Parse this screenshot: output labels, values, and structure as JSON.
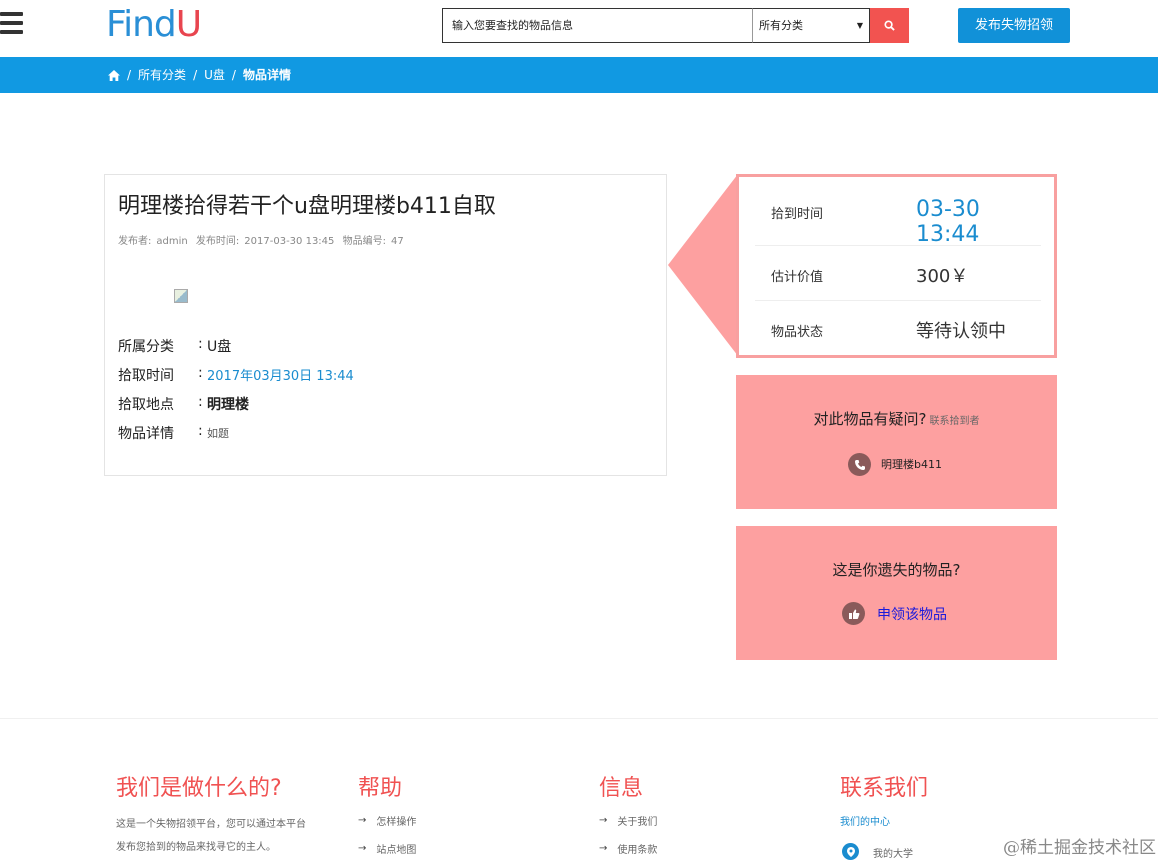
{
  "header": {
    "logo_part1": "Find",
    "logo_part2": "U",
    "search_placeholder": "输入您要查找的物品信息",
    "category_selected": "所有分类",
    "publish_label": "发布失物招领"
  },
  "breadcrumb": {
    "items": [
      "所有分类",
      "U盘",
      "物品详情"
    ]
  },
  "item": {
    "title": "明理楼拾得若干个u盘明理楼b411自取",
    "publisher_label": "发布者:",
    "publisher": "admin",
    "time_label": "发布时间:",
    "time": "2017-03-30 13:45",
    "id_label": "物品编号:",
    "id": "47",
    "details": [
      {
        "label": "所属分类",
        "value": "U盘"
      },
      {
        "label": "拾取时间",
        "value": "2017年03月30日 13:44"
      },
      {
        "label": "拾取地点",
        "value": "明理楼"
      },
      {
        "label": "物品详情",
        "value": "如题"
      }
    ]
  },
  "info": {
    "rows": [
      {
        "key": "拾到时间",
        "value": "03-30 13:44"
      },
      {
        "key": "估计价值",
        "value": "300￥"
      },
      {
        "key": "物品状态",
        "value": "等待认领中"
      }
    ]
  },
  "contact_box": {
    "question": "对此物品有疑问?",
    "hint": "联系拾到者",
    "contact": "明理楼b411"
  },
  "claim_box": {
    "question": "这是你遗失的物品?",
    "link": "申领该物品"
  },
  "footer": {
    "about_title": "我们是做什么的?",
    "about_text1": "这是一个失物招领平台，您可以通过本平台",
    "about_text2": "发布您拾到的物品来找寻它的主人。",
    "help_title": "帮助",
    "help_links": [
      "怎样操作",
      "站点地图"
    ],
    "info_title": "信息",
    "info_links": [
      "关于我们",
      "使用条款"
    ],
    "contact_title": "联系我们",
    "contact_link": "我们的中心",
    "contact_school": "我的大学"
  },
  "watermark": "@稀土掘金技术社区",
  "colors": {
    "brand_blue": "#1199e2",
    "accent_red": "#f25350",
    "pink": "#fda0a0"
  }
}
